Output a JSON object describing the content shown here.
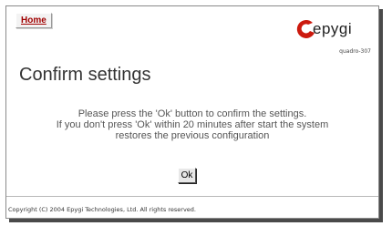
{
  "header": {
    "home_label": "Home",
    "logo_text": "epygi",
    "model": "quadro-307"
  },
  "main": {
    "title": "Confirm settings",
    "message_lines": [
      "Please press the 'Ok' button to confirm the settings.",
      "If you don't press 'Ok' within 20 minutes after start the system",
      "restores the previous configuration"
    ],
    "ok_label": "Ok"
  },
  "footer": {
    "copyright": "Copyright (C) 2004 Epygi Technologies, Ltd. All rights reserved."
  },
  "colors": {
    "home_link": "#a00000",
    "logo_accent": "#cc1a0e",
    "text": "#555555"
  }
}
